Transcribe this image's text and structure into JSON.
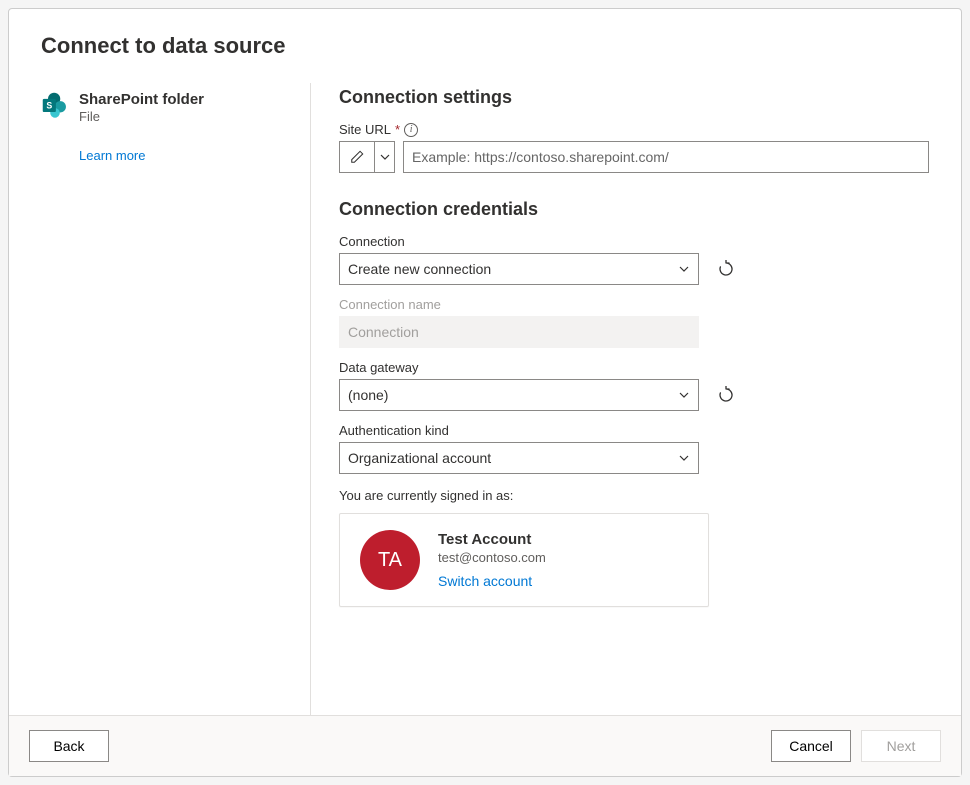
{
  "header": {
    "title": "Connect to data source"
  },
  "sidebar": {
    "source_title": "SharePoint folder",
    "source_subtitle": "File",
    "learn_more": "Learn more"
  },
  "settings": {
    "section_title": "Connection settings",
    "site_url_label": "Site URL",
    "site_url_placeholder": "Example: https://contoso.sharepoint.com/"
  },
  "credentials": {
    "section_title": "Connection credentials",
    "connection_label": "Connection",
    "connection_value": "Create new connection",
    "connection_name_label": "Connection name",
    "connection_name_value": "Connection",
    "gateway_label": "Data gateway",
    "gateway_value": "(none)",
    "auth_label": "Authentication kind",
    "auth_value": "Organizational account",
    "signed_in_label": "You are currently signed in as:",
    "account": {
      "initials": "TA",
      "name": "Test Account",
      "email": "test@contoso.com",
      "switch": "Switch account"
    }
  },
  "footer": {
    "back": "Back",
    "cancel": "Cancel",
    "next": "Next"
  }
}
